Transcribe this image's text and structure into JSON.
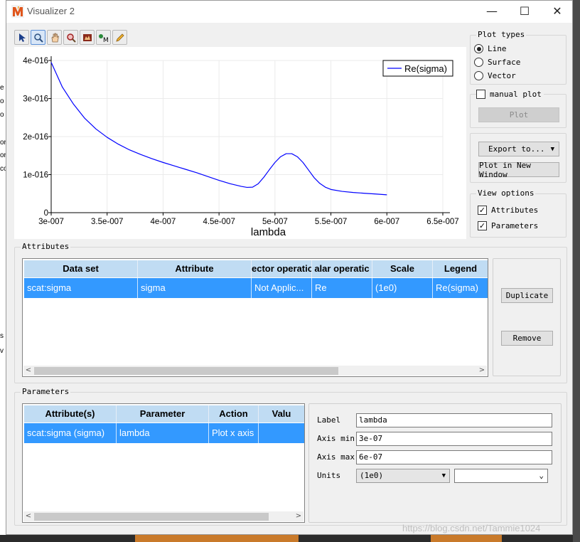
{
  "window": {
    "title": "Visualizer 2",
    "controls": {
      "minimize": "—",
      "maximize": "☐",
      "close": "✕"
    }
  },
  "toolbar": {
    "tools": [
      {
        "icon": "arrow-select-icon"
      },
      {
        "icon": "zoom-icon"
      },
      {
        "icon": "pan-hand-icon"
      },
      {
        "icon": "zoom-reset-icon"
      },
      {
        "icon": "image-export-icon"
      },
      {
        "icon": "matlab-export-icon"
      },
      {
        "icon": "pencil-icon"
      }
    ]
  },
  "chart_data": {
    "type": "line",
    "title": "",
    "xlabel": "lambda",
    "ylabel": "",
    "xlim": [
      3e-07,
      6.5e-07
    ],
    "ylim": [
      0,
      4e-16
    ],
    "x_ticks": [
      "3e-007",
      "3.5e-007",
      "4e-007",
      "4.5e-007",
      "5e-007",
      "5.5e-007",
      "6e-007",
      "6.5e-007"
    ],
    "y_ticks": [
      "0",
      "1e-016",
      "2e-016",
      "3e-016",
      "4e-016"
    ],
    "grid": true,
    "legend_position": "top-right",
    "series": [
      {
        "name": "Re(sigma)",
        "color": "#0000ff",
        "x": [
          3e-07,
          3.1e-07,
          3.2e-07,
          3.3e-07,
          3.4e-07,
          3.5e-07,
          3.6e-07,
          3.7e-07,
          3.8e-07,
          3.9e-07,
          4e-07,
          4.1e-07,
          4.2e-07,
          4.3e-07,
          4.4e-07,
          4.5e-07,
          4.6e-07,
          4.7e-07,
          4.75e-07,
          4.8e-07,
          4.85e-07,
          4.9e-07,
          4.95e-07,
          5e-07,
          5.05e-07,
          5.1e-07,
          5.15e-07,
          5.2e-07,
          5.25e-07,
          5.3e-07,
          5.35e-07,
          5.4e-07,
          5.45e-07,
          5.5e-07,
          5.6e-07,
          5.7e-07,
          5.8e-07,
          5.9e-07,
          6e-07
        ],
        "y": [
          3.95e-16,
          3.3e-16,
          2.85e-16,
          2.48e-16,
          2.2e-16,
          1.98e-16,
          1.8e-16,
          1.65e-16,
          1.53e-16,
          1.42e-16,
          1.32e-16,
          1.23e-16,
          1.14e-16,
          1.05e-16,
          9.5e-17,
          8.5e-17,
          7.6e-17,
          6.9e-17,
          6.65e-17,
          6.7e-17,
          7.6e-17,
          9.3e-17,
          1.13e-16,
          1.32e-16,
          1.47e-16,
          1.55e-16,
          1.55e-16,
          1.47e-16,
          1.32e-16,
          1.12e-16,
          9.2e-17,
          7.7e-17,
          6.7e-17,
          6.1e-17,
          5.6e-17,
          5.3e-17,
          5.1e-17,
          4.9e-17,
          4.7e-17
        ]
      }
    ]
  },
  "plot_types": {
    "title": "Plot types",
    "options": [
      "Line",
      "Surface",
      "Vector"
    ],
    "selected": "Line"
  },
  "manual_plot": {
    "label": "manual plot",
    "checked": false,
    "plot_button": "Plot"
  },
  "export": {
    "export_button": "Export to...",
    "new_window_button": "Plot in New Window"
  },
  "view_options": {
    "title": "View options",
    "attributes": {
      "label": "Attributes",
      "checked": true
    },
    "parameters": {
      "label": "Parameters",
      "checked": true
    }
  },
  "attributes": {
    "title": "Attributes",
    "columns": [
      "Data set",
      "Attribute",
      "ector operatio",
      "alar operatic",
      "Scale",
      "Legend"
    ],
    "rows": [
      [
        "scat:sigma",
        "sigma",
        "Not Applic...",
        "Re",
        "(1e0)",
        "Re(sigma)"
      ]
    ],
    "duplicate_button": "Duplicate",
    "remove_button": "Remove"
  },
  "parameters": {
    "title": "Parameters",
    "columns": [
      "Attribute(s)",
      "Parameter",
      "Action",
      "Valu"
    ],
    "rows": [
      [
        "scat:sigma (sigma)",
        "lambda",
        "Plot x axis",
        ""
      ]
    ],
    "label_field": {
      "label": "Label",
      "value": "lambda"
    },
    "axis_min_field": {
      "label": "Axis min",
      "value": "3e-07"
    },
    "axis_max_field": {
      "label": "Axis max",
      "value": "6e-07"
    },
    "units": {
      "label": "Units",
      "selected": "(1e0)",
      "second": ""
    }
  },
  "background": {
    "left_fragments": [
      "e",
      "o",
      "o",
      "or",
      "or",
      "co",
      "s",
      "v"
    ]
  },
  "watermark": "https://blog.csdn.net/Tammie1024"
}
